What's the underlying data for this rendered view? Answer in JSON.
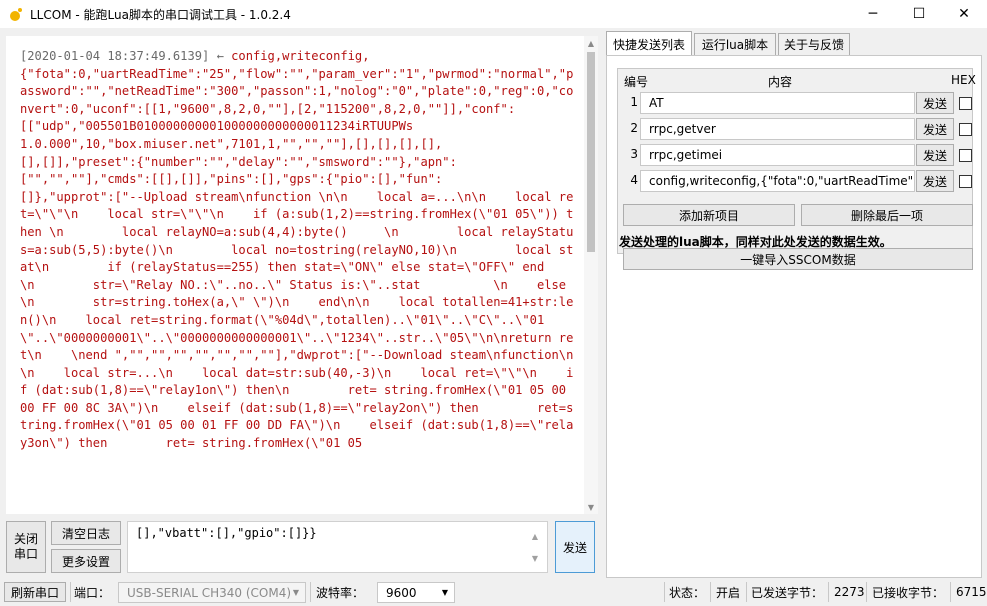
{
  "window": {
    "title": "LLCOM - 能跑Lua脚本的串口调试工具 - 1.0.2.4",
    "minimize_glyph": "─",
    "maximize_glyph": "☐",
    "close_glyph": "✕"
  },
  "log": {
    "timestamp": "[2020-01-04 18:37:49.6139]",
    "arrow": "←",
    "content": " config,writeconfig,\n{\"fota\":0,\"uartReadTime\":\"25\",\"flow\":\"\",\"param_ver\":\"1\",\"pwrmod\":\"normal\",\"password\":\"\",\"netReadTime\":\"300\",\"passon\":1,\"nolog\":\"0\",\"plate\":0,\"reg\":0,\"convert\":0,\"uconf\":[[1,\"9600\",8,2,0,\"\"],[2,\"115200\",8,2,0,\"\"]],\"conf\":\n[[\"udp\",\"005501B010000000001000000000000011234iRTUUPWs\n1.0.000\",10,\"box.miuser.net\",7101,1,\"\",\"\",\"\"],[],[],[],[],\n[],[]],\"preset\":{\"number\":\"\",\"delay\":\"\",\"smsword\":\"\"},\"apn\":\n[\"\",\"\",\"\"],\"cmds\":[[],[]],\"pins\":[],\"gps\":{\"pio\":[],\"fun\":\n[]},\"upprot\":[\"--Upload stream\\nfunction \\n\\n    local a=...\\n\\n    local ret=\\\"\\\"\\n    local str=\\\"\\\"\\n    if (a:sub(1,2)==string.fromHex(\\\"01 05\\\")) then \\n        local relayNO=a:sub(4,4):byte()     \\n        local relayStatus=a:sub(5,5):byte()\\n        local no=tostring(relayNO,10)\\n        local stat\\n        if (relayStatus==255) then stat=\\\"ON\\\" else stat=\\\"OFF\\\" end        \\n        str=\\\"Relay NO.:\\\"..no..\\\" Status is:\\\"..stat          \\n    else\\n        str=string.toHex(a,\\\" \\\")\\n    end\\n\\n    local totallen=41+str:len()\\n    local ret=string.format(\\\"%04d\\\",totallen)..\\\"01\\\"..\\\"C\\\"..\\\"01\\\"..\\\"0000000001\\\"..\\\"0000000000000001\\\"..\\\"1234\\\"..str..\\\"05\\\"\\n\\nreturn ret\\n    \\nend \",\"\",\"\",\"\",\"\",\"\",\"\",\"\"],\"dwprot\":[\"--Download steam\\nfunction\\n\\n    local str=...\\n    local dat=str:sub(40,-3)\\n    local ret=\\\"\\\"\\n    if (dat:sub(1,8)==\\\"relay1on\\\") then\\n        ret= string.fromHex(\\\"01 05 00 00 FF 00 8C 3A\\\")\\n    elseif (dat:sub(1,8)==\\\"relay2on\\\") then        ret=string.fromHex(\\\"01 05 00 01 FF 00 DD FA\\\")\\n    elseif (dat:sub(1,8)==\\\"relay3on\\\") then        ret= string.fromHex(\\\"01 05"
  },
  "send_area": {
    "close_port_label": "关闭\n串口",
    "clear_log_label": "清空日志",
    "more_settings_label": "更多设置",
    "input_value": "[],\"vbatt\":[],\"gpio\":[]}}",
    "send_label": "发送"
  },
  "tabs": [
    {
      "label": "快捷发送列表",
      "active": true
    },
    {
      "label": "运行lua脚本",
      "active": false
    },
    {
      "label": "关于与反馈",
      "active": false
    }
  ],
  "quick_send": {
    "header_num": "编号",
    "header_content": "内容",
    "header_hex": "HEX",
    "rows": [
      {
        "num": "1",
        "content": "AT",
        "send_label": "发送",
        "hex": false
      },
      {
        "num": "2",
        "content": "rrpc,getver",
        "send_label": "发送",
        "hex": false
      },
      {
        "num": "3",
        "content": "rrpc,getimei",
        "send_label": "发送",
        "hex": false
      },
      {
        "num": "4",
        "content": "config,writeconfig,{\"fota\":0,\"uartReadTime\"",
        "send_label": "发送",
        "hex": false
      }
    ],
    "add_item_label": "添加新项目",
    "delete_last_label": "删除最后一项",
    "lua_note": "发送处理的lua脚本，同样对此处发送的数据生效。",
    "import_sscom_label": "一键导入SSCOM数据"
  },
  "statusbar": {
    "refresh_port_label": "刷新串口",
    "port_label": "端口：",
    "port_value": "USB-SERIAL CH340 (COM4)",
    "baud_label": "波特率：",
    "baud_value": "9600",
    "status_label": "状态：",
    "status_value": "开启",
    "sent_bytes_label": "已发送字节：",
    "sent_bytes_value": "2273",
    "recv_bytes_label": "已接收字节：",
    "recv_bytes_value": "6715"
  },
  "colors": {
    "log_text": "#b51111",
    "accent_border": "#4c9bd6"
  }
}
